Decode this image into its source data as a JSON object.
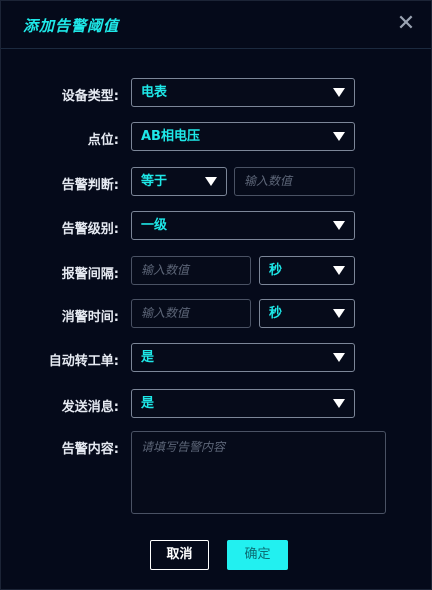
{
  "dialog": {
    "title": "添加告警阈值",
    "close_symbol": "✕"
  },
  "form": {
    "device_type": {
      "label": "设备类型:",
      "value": "电表"
    },
    "point": {
      "label": "点位:",
      "value": "AB相电压"
    },
    "judgement": {
      "label": "告警判断:",
      "operator": "等于",
      "input_placeholder": "输入数值"
    },
    "level": {
      "label": "告警级别:",
      "value": "一级"
    },
    "alarm_interval": {
      "label": "报警间隔:",
      "input_placeholder": "输入数值",
      "unit": "秒"
    },
    "clear_time": {
      "label": "消警时间:",
      "input_placeholder": "输入数值",
      "unit": "秒"
    },
    "auto_ticket": {
      "label": "自动转工单:",
      "value": "是"
    },
    "send_message": {
      "label": "发送消息:",
      "value": "是"
    },
    "content": {
      "label": "告警内容:",
      "placeholder": "请填写告警内容"
    }
  },
  "buttons": {
    "cancel": "取消",
    "confirm": "确定"
  },
  "colors": {
    "accent": "#1ee8e8",
    "background": "#050a1a",
    "confirm_bg": "#22f0f0"
  }
}
